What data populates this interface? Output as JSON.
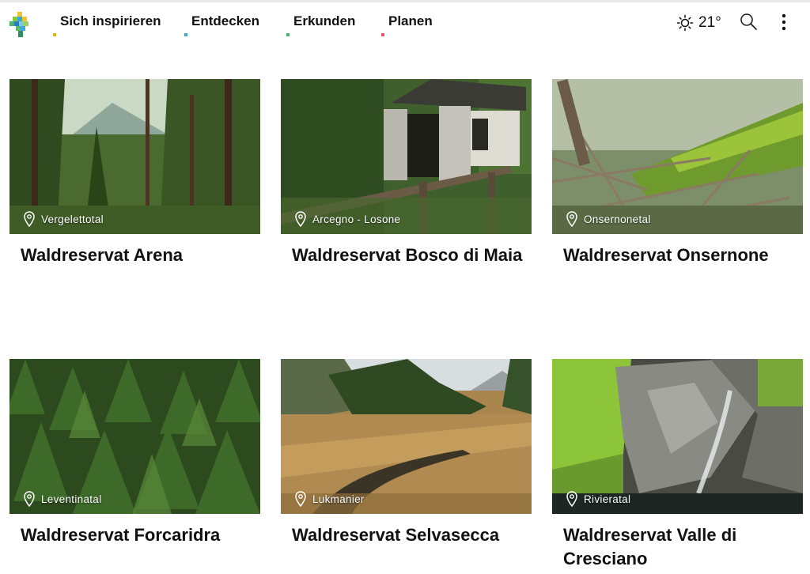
{
  "nav": {
    "items": [
      {
        "label": "Sich inspirieren",
        "accent": "#e8b400"
      },
      {
        "label": "Entdecken",
        "accent": "#3aa8d8"
      },
      {
        "label": "Erkunden",
        "accent": "#48b56b"
      },
      {
        "label": "Planen",
        "accent": "#e05a6a"
      }
    ]
  },
  "weather": {
    "icon": "sun-icon",
    "temperature": "21°"
  },
  "icons": {
    "search": "search-icon",
    "menu": "more-vertical-icon",
    "location": "map-pin-icon"
  },
  "cards": [
    {
      "location": "Vergelettotal",
      "title": "Waldreservat Arena"
    },
    {
      "location": "Arcegno - Losone",
      "title": "Waldreservat Bosco di Maia"
    },
    {
      "location": "Onsernonetal",
      "title": "Waldreservat Onsernone"
    },
    {
      "location": "Leventinatal",
      "title": "Waldreservat Forcaridra"
    },
    {
      "location": "Lukmanier",
      "title": "Waldreservat Selvasecca"
    },
    {
      "location": "Rivieratal",
      "title": "Waldreservat Valle di Cresciano"
    }
  ]
}
